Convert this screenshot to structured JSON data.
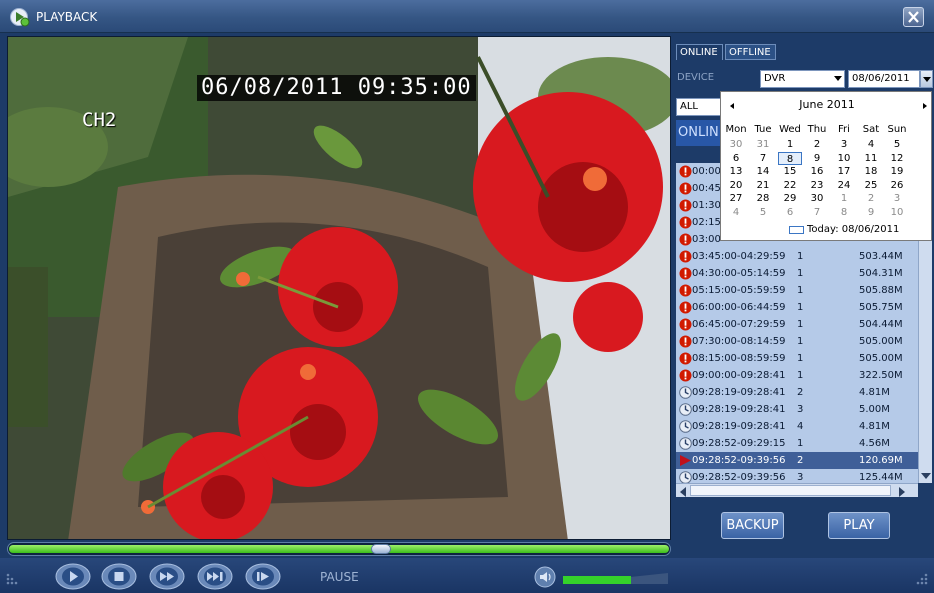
{
  "window": {
    "title": "PLAYBACK",
    "icon": "playback-app-icon",
    "close_icon": "close-icon"
  },
  "video": {
    "osd_datetime": "06/08/2011 09:35:00",
    "channel": "CH2"
  },
  "playback": {
    "progress_fraction": 0.55
  },
  "controls": {
    "buttons": [
      "play-icon",
      "stop-icon",
      "fast-forward-icon",
      "step-forward-icon",
      "frame-advance-icon"
    ],
    "status_label": "PAUSE",
    "volume_icon": "speaker-icon",
    "volume_fraction": 0.65
  },
  "panel": {
    "tabs": [
      {
        "label": "ONLINE"
      },
      {
        "label": "OFFLINE"
      }
    ],
    "device_label": "DEVICE",
    "device_value": "DVR",
    "date_value": "08/06/2011",
    "filter_value": "ALL",
    "online_header": "ONLIN",
    "files": [
      {
        "time": "00:00",
        "ch": "",
        "size": "",
        "type": "alarm"
      },
      {
        "time": "00:45",
        "ch": "",
        "size": "",
        "type": "alarm"
      },
      {
        "time": "01:30",
        "ch": "",
        "size": "",
        "type": "alarm"
      },
      {
        "time": "02:15",
        "ch": "",
        "size": "",
        "type": "alarm"
      },
      {
        "time": "03:00",
        "ch": "",
        "size": "",
        "type": "alarm"
      },
      {
        "time": "03:45:00-04:29:59",
        "ch": "1",
        "size": "503.44M",
        "type": "alarm"
      },
      {
        "time": "04:30:00-05:14:59",
        "ch": "1",
        "size": "504.31M",
        "type": "alarm"
      },
      {
        "time": "05:15:00-05:59:59",
        "ch": "1",
        "size": "505.88M",
        "type": "alarm"
      },
      {
        "time": "06:00:00-06:44:59",
        "ch": "1",
        "size": "505.75M",
        "type": "alarm"
      },
      {
        "time": "06:45:00-07:29:59",
        "ch": "1",
        "size": "504.44M",
        "type": "alarm"
      },
      {
        "time": "07:30:00-08:14:59",
        "ch": "1",
        "size": "505.00M",
        "type": "alarm"
      },
      {
        "time": "08:15:00-08:59:59",
        "ch": "1",
        "size": "505.00M",
        "type": "alarm"
      },
      {
        "time": "09:00:00-09:28:41",
        "ch": "1",
        "size": "322.50M",
        "type": "alarm"
      },
      {
        "time": "09:28:19-09:28:41",
        "ch": "2",
        "size": "4.81M",
        "type": "motion"
      },
      {
        "time": "09:28:19-09:28:41",
        "ch": "3",
        "size": "5.00M",
        "type": "motion"
      },
      {
        "time": "09:28:19-09:28:41",
        "ch": "4",
        "size": "4.81M",
        "type": "motion"
      },
      {
        "time": "09:28:52-09:29:15",
        "ch": "1",
        "size": "4.56M",
        "type": "motion"
      },
      {
        "time": "09:28:52-09:39:56",
        "ch": "2",
        "size": "120.69M",
        "type": "playing",
        "selected": true
      },
      {
        "time": "09:28:52-09:39:56",
        "ch": "3",
        "size": "125.44M",
        "type": "motion"
      }
    ],
    "backup_label": "BACKUP",
    "play_label": "PLAY"
  },
  "calendar": {
    "title": "June 2011",
    "weekdays": [
      "Mon",
      "Tue",
      "Wed",
      "Thu",
      "Fri",
      "Sat",
      "Sun"
    ],
    "weeks": [
      [
        "30",
        "31",
        "1",
        "2",
        "3",
        "4",
        "5"
      ],
      [
        "6",
        "7",
        "8",
        "9",
        "10",
        "11",
        "12"
      ],
      [
        "13",
        "14",
        "15",
        "16",
        "17",
        "18",
        "19"
      ],
      [
        "20",
        "21",
        "22",
        "23",
        "24",
        "25",
        "26"
      ],
      [
        "27",
        "28",
        "29",
        "30",
        "1",
        "2",
        "3"
      ],
      [
        "4",
        "5",
        "6",
        "7",
        "8",
        "9",
        "10"
      ]
    ],
    "selected_day": "8",
    "today_label": "Today: 08/06/2011"
  },
  "colors": {
    "accent": "#2857a7",
    "progress": "#3cbe1b",
    "alarm": "#d11a00",
    "list_bg": "#b5cae8"
  }
}
